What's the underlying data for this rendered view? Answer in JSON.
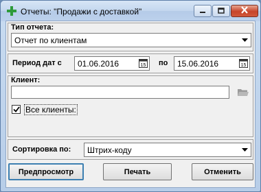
{
  "window": {
    "title": "Отчеты: \"Продажи с доставкой\""
  },
  "report_type": {
    "label": "Тип отчета:",
    "selected": "Отчет по клиентам"
  },
  "period": {
    "label_from": "Период дат с",
    "date_from": "01.06.2016",
    "label_to": "по",
    "date_to": "15.06.2016",
    "calendar_glyph": "15"
  },
  "client": {
    "label": "Клиент:",
    "value": "",
    "all_clients_label": "Все клиенты:",
    "all_clients_checked": true
  },
  "sort": {
    "label": "Сортировка по:",
    "selected": "Штрих-коду"
  },
  "buttons": {
    "preview": "Предпросмотр",
    "print": "Печать",
    "cancel": "Отменить"
  },
  "colors": {
    "app_icon": "#2e9a3a",
    "close_button": "#c7442a",
    "default_button_border": "#3c7fb1"
  },
  "icons": {
    "app": "plus-icon",
    "minimize": "minimize-icon",
    "maximize": "maximize-icon",
    "close": "close-icon",
    "dropdown": "chevron-down-icon",
    "calendar": "calendar-icon",
    "folder": "folder-icon",
    "checkmark": "checkmark-icon"
  }
}
